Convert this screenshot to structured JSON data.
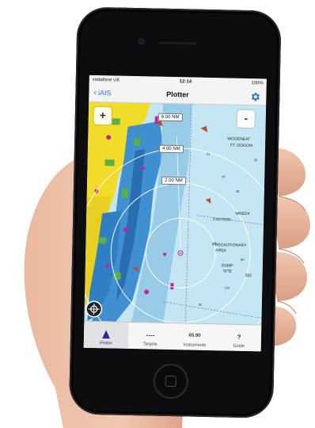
{
  "status_bar": {
    "carrier": "vodafone UK",
    "time": "12:14",
    "battery": "100%"
  },
  "nav_bar": {
    "back_label": "iAIS",
    "title": "Plotter",
    "settings_icon": "gear-icon"
  },
  "map": {
    "zoom_in_label": "+",
    "zoom_out_label": "-",
    "range_rings": [
      "6.00 NM",
      "4.00 NM",
      "2.00 NM"
    ],
    "chart_labels": [
      "WOODNEAT",
      "FT. DOGOM",
      "CAUTION",
      "WRECK",
      "PRECAUTIONARY",
      "AREA",
      "DUMP",
      "SITE",
      "202"
    ]
  },
  "tab_bar": {
    "tabs": [
      {
        "label": "Plotter",
        "icon": "triangle-icon",
        "active": true
      },
      {
        "label": "Targets",
        "icon_text": "----",
        "active": false
      },
      {
        "label": "Instruments",
        "icon_text": "65.90",
        "active": false
      },
      {
        "label": "Guide",
        "icon_text": "?",
        "active": false
      }
    ]
  },
  "colors": {
    "land": "#f2dc2a",
    "shallow_water": "#3f8fd1",
    "deep_water": "#bfe3f0",
    "ios_blue": "#2a78d6"
  }
}
